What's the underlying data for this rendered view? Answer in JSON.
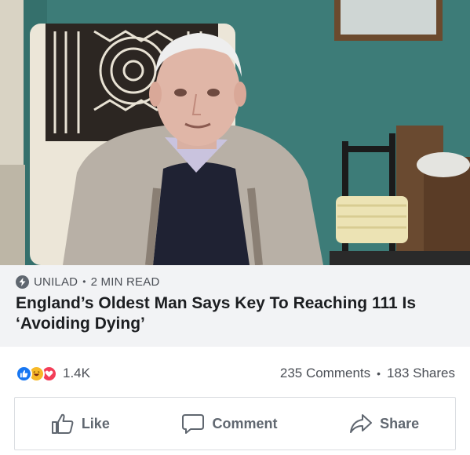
{
  "article": {
    "source": "UNILAD",
    "read_time": "2 MIN READ",
    "separator": "•",
    "headline": "England’s Oldest Man Says Key To Reaching 111 Is ‘Avoiding Dying’",
    "image_icon": "photo-of-elderly-man-in-armchair"
  },
  "reactions": {
    "icons": [
      "like-reaction-icon",
      "haha-reaction-icon",
      "love-reaction-icon"
    ],
    "count": "1.4K",
    "comments": "235 Comments",
    "separator": "•",
    "shares": "183 Shares"
  },
  "actions": {
    "like_label": "Like",
    "comment_label": "Comment",
    "share_label": "Share"
  },
  "colors": {
    "like_blue": "#1877f2",
    "haha_yellow": "#f7b928",
    "love_red": "#f33e58",
    "caption_bg": "#f2f3f5",
    "wall_teal": "#3f7f7a"
  }
}
